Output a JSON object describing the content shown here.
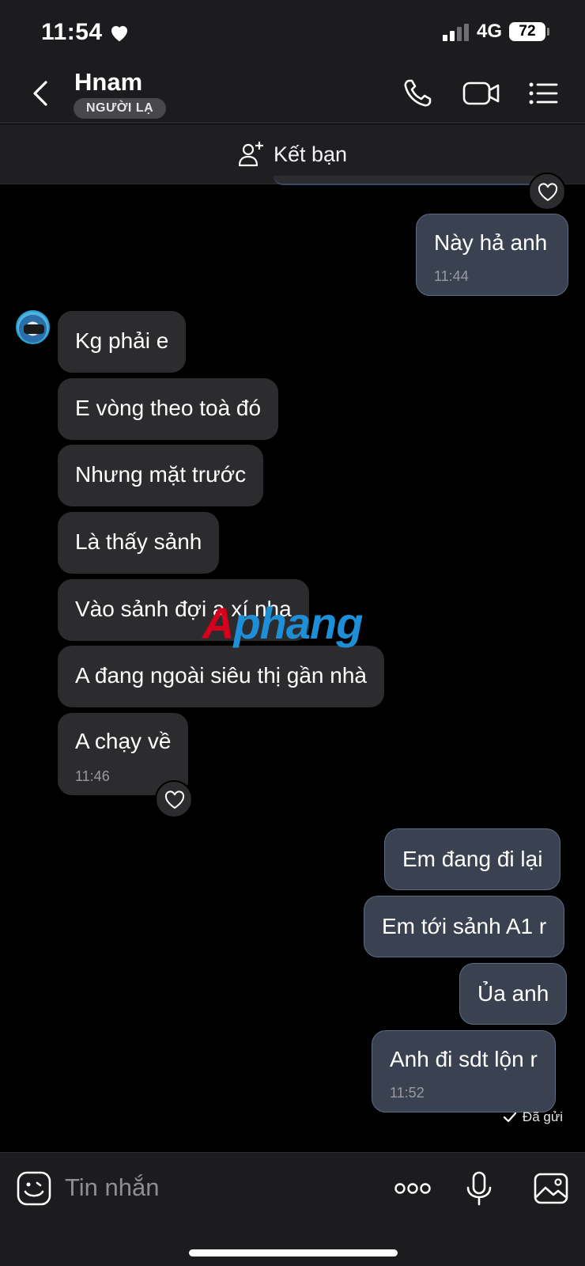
{
  "status_bar": {
    "time": "11:54",
    "network": "4G",
    "battery": "72"
  },
  "header": {
    "contact_name": "Hnam",
    "badge": "NGƯỜI LẠ"
  },
  "add_friend": {
    "label": "Kết bạn"
  },
  "messages": {
    "out_top": {
      "text": "Này hả anh",
      "time": "11:44"
    },
    "incoming": [
      "Kg phải e",
      "E vòng theo toà đó",
      "Nhưng mặt trước",
      "Là thấy sảnh",
      "Vào sảnh đợi a xí nha",
      "A đang ngoài siêu thị gần nhà",
      "A chạy về"
    ],
    "incoming_time": "11:46",
    "outgoing": [
      "Em đang đi lại",
      "Em tới sảnh A1 r",
      "Ủa anh",
      "Anh đi sdt lộn r"
    ],
    "outgoing_time": "11:52",
    "sent_status": "Đã gửi"
  },
  "watermark": {
    "first": "A",
    "rest": "phang"
  },
  "input": {
    "placeholder": "Tin nhắn"
  },
  "colors": {
    "outgoing_bubble": "#3a4150",
    "incoming_bubble": "#2c2c2e",
    "background": "#000000",
    "watermark_red": "#d6001c",
    "watermark_blue": "#1d8fd6"
  },
  "icons": [
    "heart-icon",
    "signal-icon",
    "back-icon",
    "phone-icon",
    "video-icon",
    "menu-icon",
    "add-person-icon",
    "sticker-icon",
    "more-icon",
    "mic-icon",
    "image-icon",
    "check-icon"
  ]
}
